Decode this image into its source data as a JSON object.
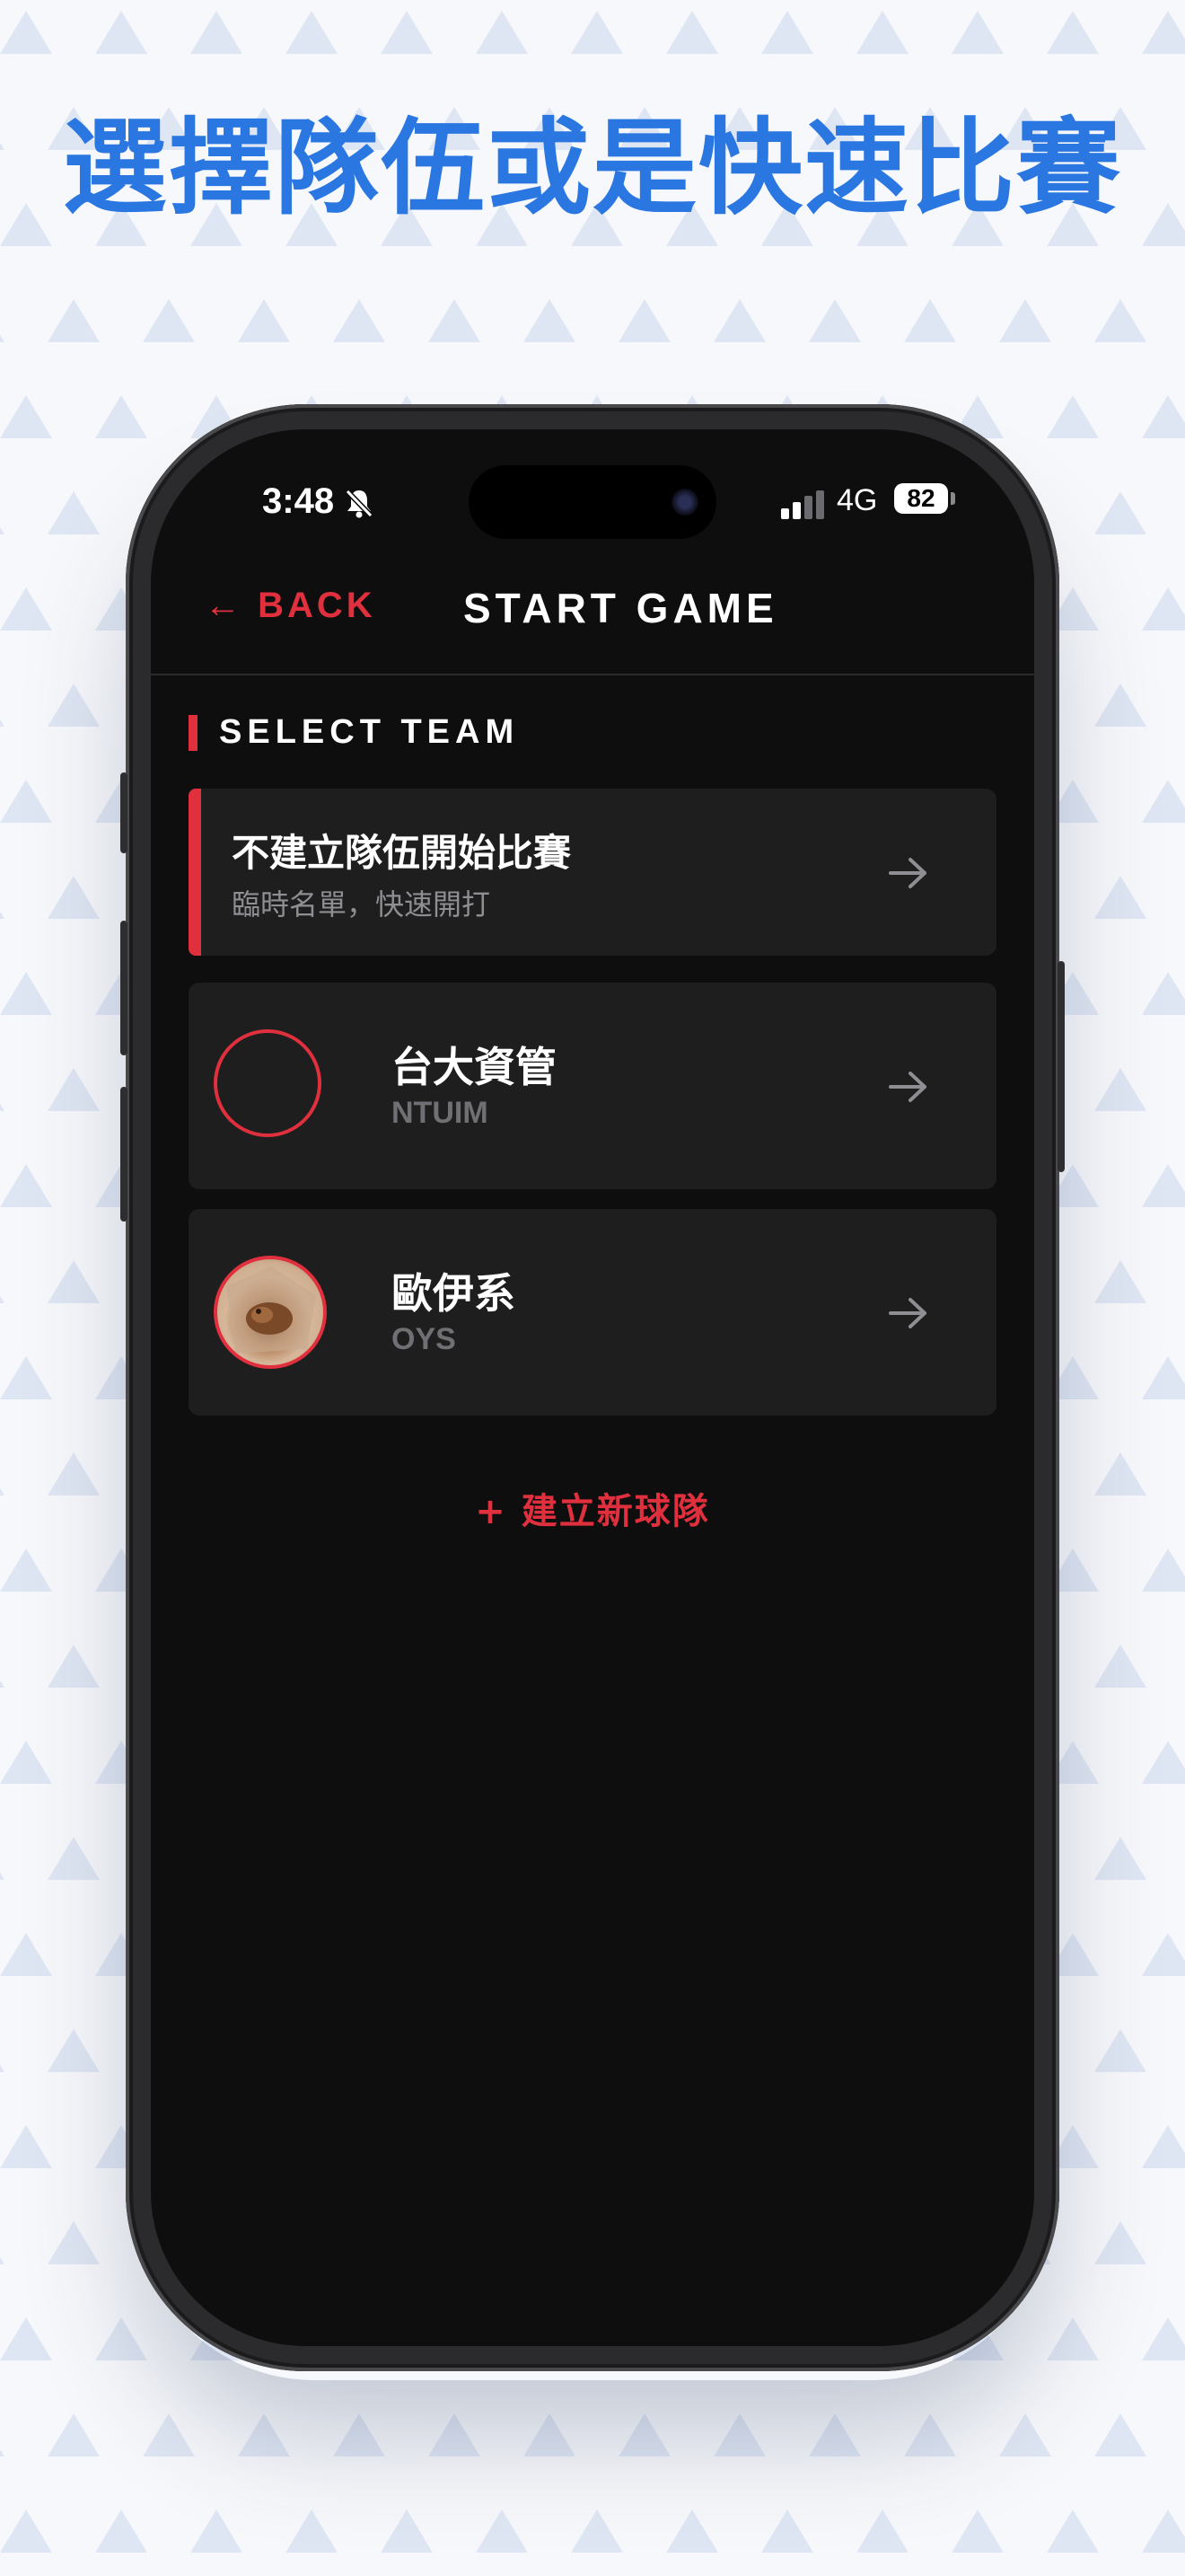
{
  "promo": {
    "headline": "選擇隊伍或是快速比賽"
  },
  "status_bar": {
    "time": "3:48",
    "network": "4G",
    "battery": "82"
  },
  "nav": {
    "back_label": "← BACK",
    "title": "START GAME"
  },
  "section": {
    "title": "SELECT TEAM"
  },
  "quick_start": {
    "title": "不建立隊伍開始比賽",
    "subtitle": "臨時名單，快速開打"
  },
  "teams": [
    {
      "name": "台大資管",
      "code": "NTUIM",
      "avatar": "empty-avatar"
    },
    {
      "name": "歐伊系",
      "code": "OYS",
      "avatar": "team-photo"
    }
  ],
  "create_team": {
    "label": "+ 建立新球隊"
  },
  "colors": {
    "accent_red": "#e0303e",
    "headline_blue": "#2a77e2",
    "screen_bg": "#0e0e0f",
    "card_bg": "#1e1e1f"
  }
}
